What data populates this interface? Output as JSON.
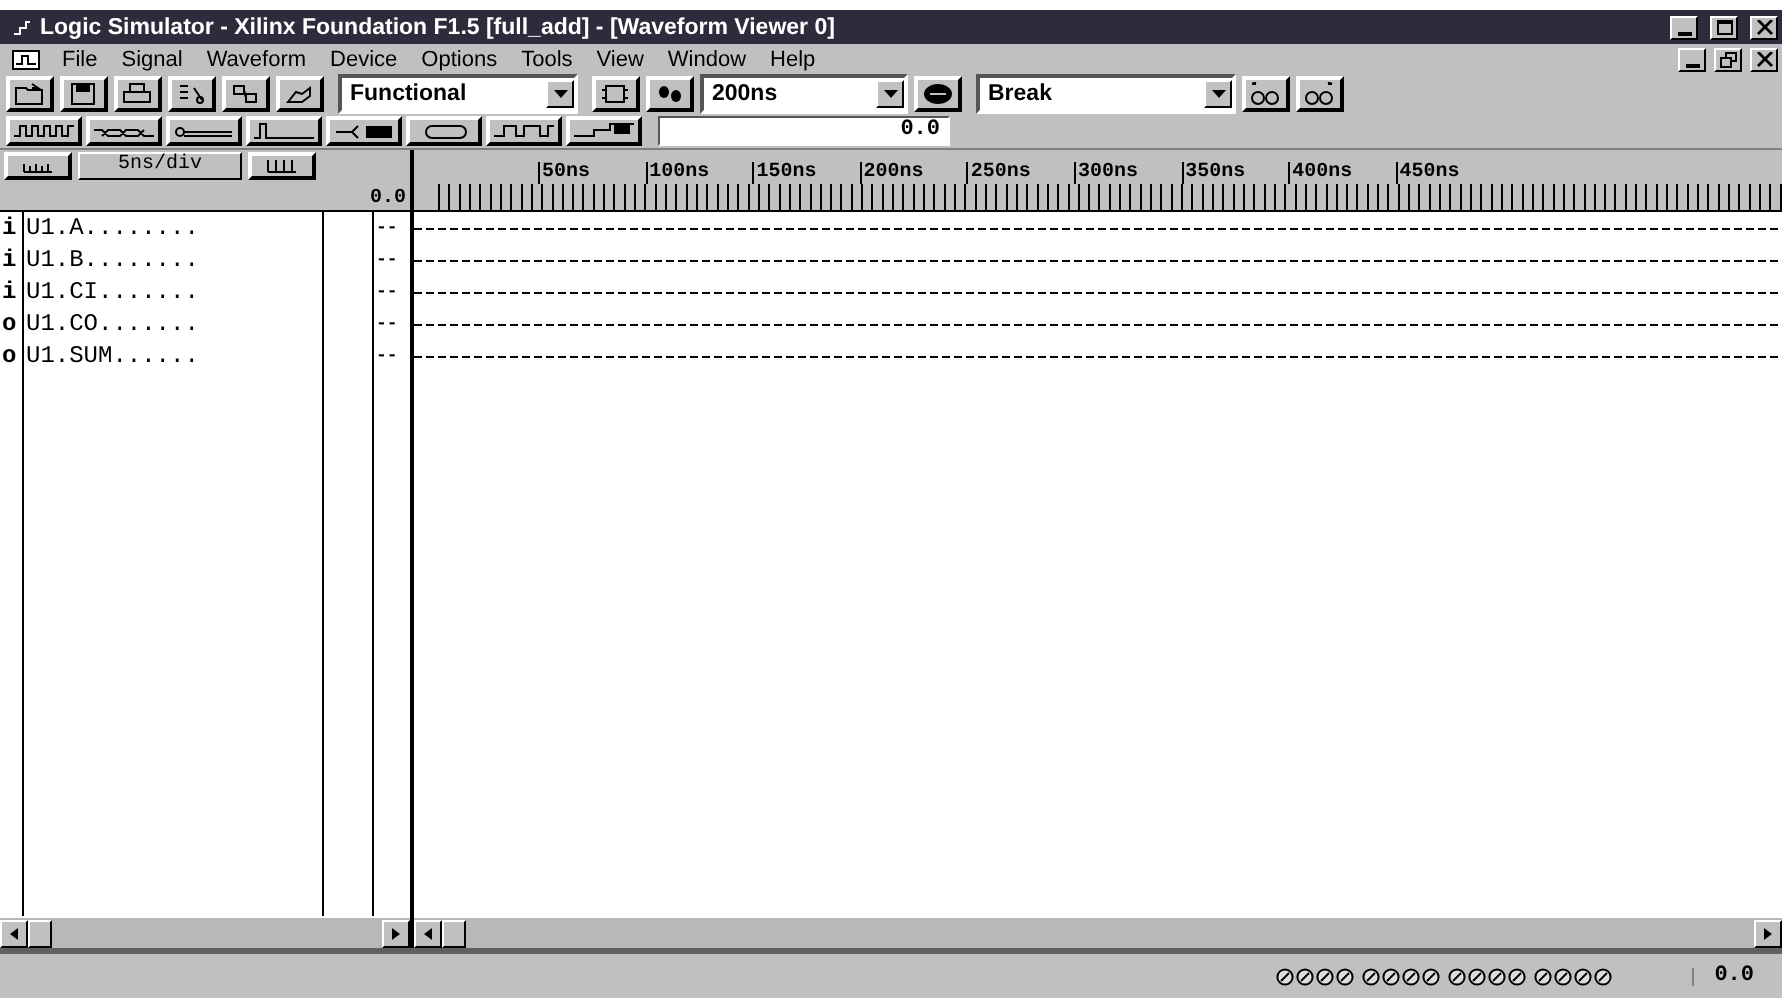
{
  "window": {
    "title": "Logic Simulator - Xilinx Foundation F1.5 [full_add] - [Waveform Viewer 0]"
  },
  "menu": [
    "File",
    "Signal",
    "Waveform",
    "Device",
    "Options",
    "Tools",
    "View",
    "Window",
    "Help"
  ],
  "toolbar": {
    "mode_select": {
      "value": "Functional"
    },
    "step_select": {
      "value": "200ns"
    },
    "break_select": {
      "value": "Break"
    }
  },
  "edit_toolbar": {
    "time_field": {
      "value": "0.0"
    }
  },
  "scale": {
    "label": "5ns/div",
    "origin": "0.0",
    "ticks": [
      "50ns",
      "100ns",
      "150ns",
      "200ns",
      "250ns",
      "300ns",
      "350ns",
      "400ns",
      "450ns"
    ]
  },
  "signals": [
    {
      "io": "i",
      "name": "U1.A........",
      "value": "--"
    },
    {
      "io": "i",
      "name": "U1.B........",
      "value": "--"
    },
    {
      "io": "i",
      "name": "U1.CI.......",
      "value": "--"
    },
    {
      "io": "o",
      "name": "U1.CO.......",
      "value": "--"
    },
    {
      "io": "o",
      "name": "U1.SUM......",
      "value": "--"
    }
  ],
  "status_bar": {
    "time": "0.0"
  }
}
